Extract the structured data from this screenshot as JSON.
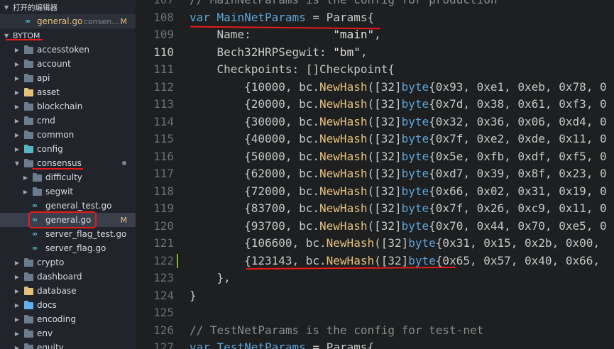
{
  "sidebar": {
    "open_editors_label": "打开的编辑器",
    "open_file": {
      "name": "general.go",
      "folder": "consen...",
      "status": "M"
    },
    "root_label": "BYTOM",
    "items": [
      {
        "label": "accesstoken",
        "kind": "folder",
        "depth": 0,
        "expanded": false
      },
      {
        "label": "account",
        "kind": "folder",
        "depth": 0,
        "expanded": false
      },
      {
        "label": "api",
        "kind": "folder",
        "depth": 0,
        "expanded": false
      },
      {
        "label": "asset",
        "kind": "folder-yellow",
        "depth": 0,
        "expanded": false
      },
      {
        "label": "blockchain",
        "kind": "folder",
        "depth": 0,
        "expanded": false
      },
      {
        "label": "cmd",
        "kind": "folder",
        "depth": 0,
        "expanded": false
      },
      {
        "label": "common",
        "kind": "folder",
        "depth": 0,
        "expanded": false
      },
      {
        "label": "config",
        "kind": "folder-teal",
        "depth": 0,
        "expanded": false
      },
      {
        "label": "consensus",
        "kind": "folder",
        "depth": 0,
        "expanded": true,
        "dot": true
      },
      {
        "label": "difficulty",
        "kind": "folder",
        "depth": 1,
        "expanded": false
      },
      {
        "label": "segwit",
        "kind": "folder",
        "depth": 1,
        "expanded": false
      },
      {
        "label": "general_test.go",
        "kind": "go",
        "depth": 1
      },
      {
        "label": "general.go",
        "kind": "go",
        "depth": 1,
        "selected": true,
        "status": "M"
      },
      {
        "label": "server_flag_test.go",
        "kind": "go",
        "depth": 1
      },
      {
        "label": "server_flag.go",
        "kind": "go",
        "depth": 1
      },
      {
        "label": "crypto",
        "kind": "folder",
        "depth": 0,
        "expanded": false
      },
      {
        "label": "dashboard",
        "kind": "folder",
        "depth": 0,
        "expanded": false
      },
      {
        "label": "database",
        "kind": "folder-yellow",
        "depth": 0,
        "expanded": false
      },
      {
        "label": "docs",
        "kind": "folder-blue",
        "depth": 0,
        "expanded": false
      },
      {
        "label": "encoding",
        "kind": "folder",
        "depth": 0,
        "expanded": false
      },
      {
        "label": "env",
        "kind": "folder",
        "depth": 0,
        "expanded": false
      },
      {
        "label": "equity",
        "kind": "folder",
        "depth": 0,
        "expanded": false
      }
    ]
  },
  "editor": {
    "current_line": "110",
    "lines": [
      {
        "n": "107",
        "tokens": [
          {
            "t": "// MainNetParams is the config for production",
            "c": "cm"
          }
        ]
      },
      {
        "n": "108",
        "tokens": [
          {
            "t": "var",
            "c": "kw"
          },
          {
            "t": " ",
            "c": "plain"
          },
          {
            "t": "MainNetParams",
            "c": "kw"
          },
          {
            "t": " = Params{",
            "c": "plain"
          }
        ]
      },
      {
        "n": "109",
        "tokens": [
          {
            "t": "    Name:            ",
            "c": "plain"
          },
          {
            "t": "\"main\"",
            "c": "str"
          },
          {
            "t": ",",
            "c": "plain"
          }
        ]
      },
      {
        "n": "110",
        "tokens": [
          {
            "t": "    Bech32HRPSegwit: ",
            "c": "plain"
          },
          {
            "t": "\"bm\"",
            "c": "str"
          },
          {
            "t": ",",
            "c": "plain"
          }
        ]
      },
      {
        "n": "111",
        "tokens": [
          {
            "t": "    Checkpoints: []Checkpoint{",
            "c": "plain"
          }
        ]
      },
      {
        "n": "112",
        "tokens": [
          {
            "t": "        {10000, bc.",
            "c": "plain"
          },
          {
            "t": "NewHash",
            "c": "fn"
          },
          {
            "t": "([32]",
            "c": "plain"
          },
          {
            "t": "byte",
            "c": "ty"
          },
          {
            "t": "{0x93, 0xe1, 0xeb, 0x78, 0",
            "c": "plain"
          }
        ]
      },
      {
        "n": "113",
        "tokens": [
          {
            "t": "        {20000, bc.",
            "c": "plain"
          },
          {
            "t": "NewHash",
            "c": "fn"
          },
          {
            "t": "([32]",
            "c": "plain"
          },
          {
            "t": "byte",
            "c": "ty"
          },
          {
            "t": "{0x7d, 0x38, 0x61, 0xf3, 0",
            "c": "plain"
          }
        ]
      },
      {
        "n": "114",
        "tokens": [
          {
            "t": "        {30000, bc.",
            "c": "plain"
          },
          {
            "t": "NewHash",
            "c": "fn"
          },
          {
            "t": "([32]",
            "c": "plain"
          },
          {
            "t": "byte",
            "c": "ty"
          },
          {
            "t": "{0x32, 0x36, 0x06, 0xd4, 0",
            "c": "plain"
          }
        ]
      },
      {
        "n": "115",
        "tokens": [
          {
            "t": "        {40000, bc.",
            "c": "plain"
          },
          {
            "t": "NewHash",
            "c": "fn"
          },
          {
            "t": "([32]",
            "c": "plain"
          },
          {
            "t": "byte",
            "c": "ty"
          },
          {
            "t": "{0x7f, 0xe2, 0xde, 0x11, 0",
            "c": "plain"
          }
        ]
      },
      {
        "n": "116",
        "tokens": [
          {
            "t": "        {50000, bc.",
            "c": "plain"
          },
          {
            "t": "NewHash",
            "c": "fn"
          },
          {
            "t": "([32]",
            "c": "plain"
          },
          {
            "t": "byte",
            "c": "ty"
          },
          {
            "t": "{0x5e, 0xfb, 0xdf, 0xf5, 0",
            "c": "plain"
          }
        ]
      },
      {
        "n": "117",
        "tokens": [
          {
            "t": "        {62000, bc.",
            "c": "plain"
          },
          {
            "t": "NewHash",
            "c": "fn"
          },
          {
            "t": "([32]",
            "c": "plain"
          },
          {
            "t": "byte",
            "c": "ty"
          },
          {
            "t": "{0xd7, 0x39, 0x8f, 0x23, 0",
            "c": "plain"
          }
        ]
      },
      {
        "n": "118",
        "tokens": [
          {
            "t": "        {72000, bc.",
            "c": "plain"
          },
          {
            "t": "NewHash",
            "c": "fn"
          },
          {
            "t": "([32]",
            "c": "plain"
          },
          {
            "t": "byte",
            "c": "ty"
          },
          {
            "t": "{0x66, 0x02, 0x31, 0x19, 0",
            "c": "plain"
          }
        ]
      },
      {
        "n": "119",
        "tokens": [
          {
            "t": "        {83700, bc.",
            "c": "plain"
          },
          {
            "t": "NewHash",
            "c": "fn"
          },
          {
            "t": "([32]",
            "c": "plain"
          },
          {
            "t": "byte",
            "c": "ty"
          },
          {
            "t": "{0x7f, 0x26, 0xc9, 0x11, 0",
            "c": "plain"
          }
        ]
      },
      {
        "n": "120",
        "tokens": [
          {
            "t": "        {93700, bc.",
            "c": "plain"
          },
          {
            "t": "NewHash",
            "c": "fn"
          },
          {
            "t": "([32]",
            "c": "plain"
          },
          {
            "t": "byte",
            "c": "ty"
          },
          {
            "t": "{0x70, 0x44, 0x70, 0xe5, 0",
            "c": "plain"
          }
        ]
      },
      {
        "n": "121",
        "tokens": [
          {
            "t": "        {106600, bc.",
            "c": "plain"
          },
          {
            "t": "NewHash",
            "c": "fn"
          },
          {
            "t": "([32]",
            "c": "plain"
          },
          {
            "t": "byte",
            "c": "ty"
          },
          {
            "t": "{0x31, 0x15, 0x2b, 0x00,",
            "c": "plain"
          }
        ]
      },
      {
        "n": "122",
        "tokens": [
          {
            "t": "        {123143, bc.",
            "c": "plain"
          },
          {
            "t": "NewHash",
            "c": "fn"
          },
          {
            "t": "([32]",
            "c": "plain"
          },
          {
            "t": "byte",
            "c": "ty"
          },
          {
            "t": "{0x65, 0x57, 0x40, 0x66,",
            "c": "plain"
          }
        ]
      },
      {
        "n": "123",
        "tokens": [
          {
            "t": "    },",
            "c": "plain"
          }
        ]
      },
      {
        "n": "124",
        "tokens": [
          {
            "t": "}",
            "c": "plain"
          }
        ]
      },
      {
        "n": "125",
        "tokens": [
          {
            "t": "",
            "c": "plain"
          }
        ]
      },
      {
        "n": "126",
        "tokens": [
          {
            "t": "// TestNetParams is the config for test-net",
            "c": "cm"
          }
        ]
      },
      {
        "n": "127",
        "tokens": [
          {
            "t": "var",
            "c": "kw"
          },
          {
            "t": " ",
            "c": "plain"
          },
          {
            "t": "TestNetParams",
            "c": "kw"
          },
          {
            "t": " = Params{",
            "c": "plain"
          }
        ]
      }
    ]
  }
}
